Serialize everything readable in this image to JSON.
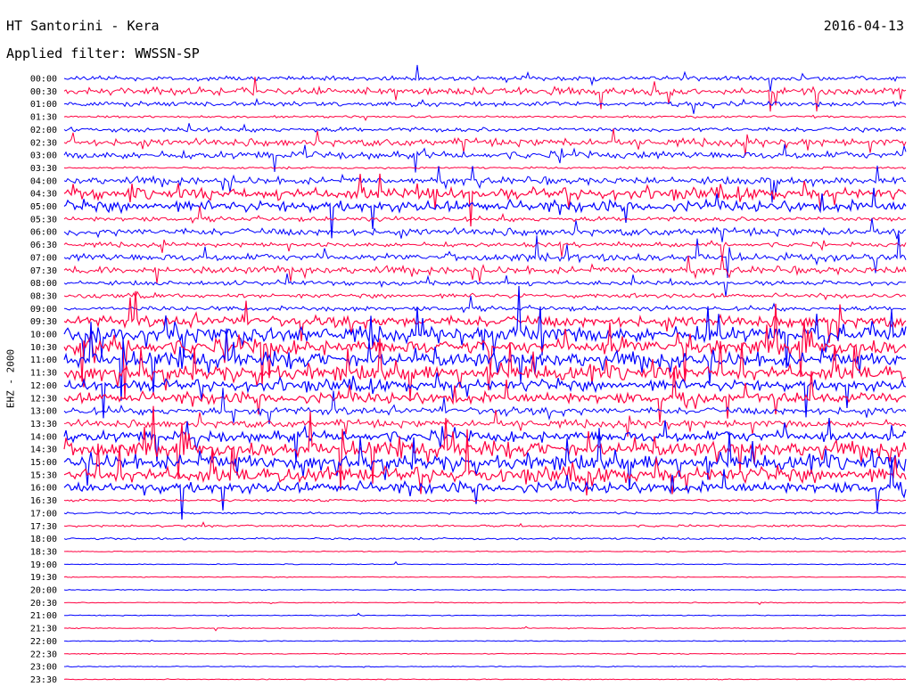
{
  "header": {
    "title": "HT Santorini - Kera",
    "date": "2016-04-13",
    "filter": "Applied filter: WWSSN-SP"
  },
  "channel_label": "EHZ - 2000",
  "chart_data": {
    "type": "line",
    "title": "HT Santorini - Kera",
    "subtitle": "Applied filter: WWSSN-SP",
    "ylabel": "EHZ - 2000",
    "row_labels": [
      "00:00",
      "00:30",
      "01:00",
      "01:30",
      "02:00",
      "02:30",
      "03:00",
      "03:30",
      "04:00",
      "04:30",
      "05:00",
      "05:30",
      "06:00",
      "06:30",
      "07:00",
      "07:30",
      "08:00",
      "08:30",
      "09:00",
      "09:30",
      "10:00",
      "10:30",
      "11:00",
      "11:30",
      "12:00",
      "12:30",
      "13:00",
      "13:30",
      "14:00",
      "14:30",
      "15:00",
      "15:30",
      "16:00",
      "16:30",
      "17:00",
      "17:30",
      "18:00",
      "18:30",
      "19:00",
      "19:30",
      "20:00",
      "20:30",
      "21:00",
      "21:30",
      "22:00",
      "22:30",
      "23:00",
      "23:30"
    ],
    "row_colors": [
      "#0000ff",
      "#ff0040"
    ],
    "activity_level": [
      2,
      3,
      2,
      1,
      2,
      3,
      3,
      1,
      3,
      4,
      4,
      2,
      3,
      2,
      3,
      3,
      2,
      2,
      2,
      4,
      5,
      5,
      5,
      5,
      4,
      4,
      3,
      3,
      4,
      5,
      5,
      5,
      4,
      1,
      1,
      1,
      1,
      0,
      0,
      0,
      0,
      0,
      0,
      0,
      0,
      0,
      0,
      0
    ],
    "grid": false,
    "legend": "none"
  }
}
